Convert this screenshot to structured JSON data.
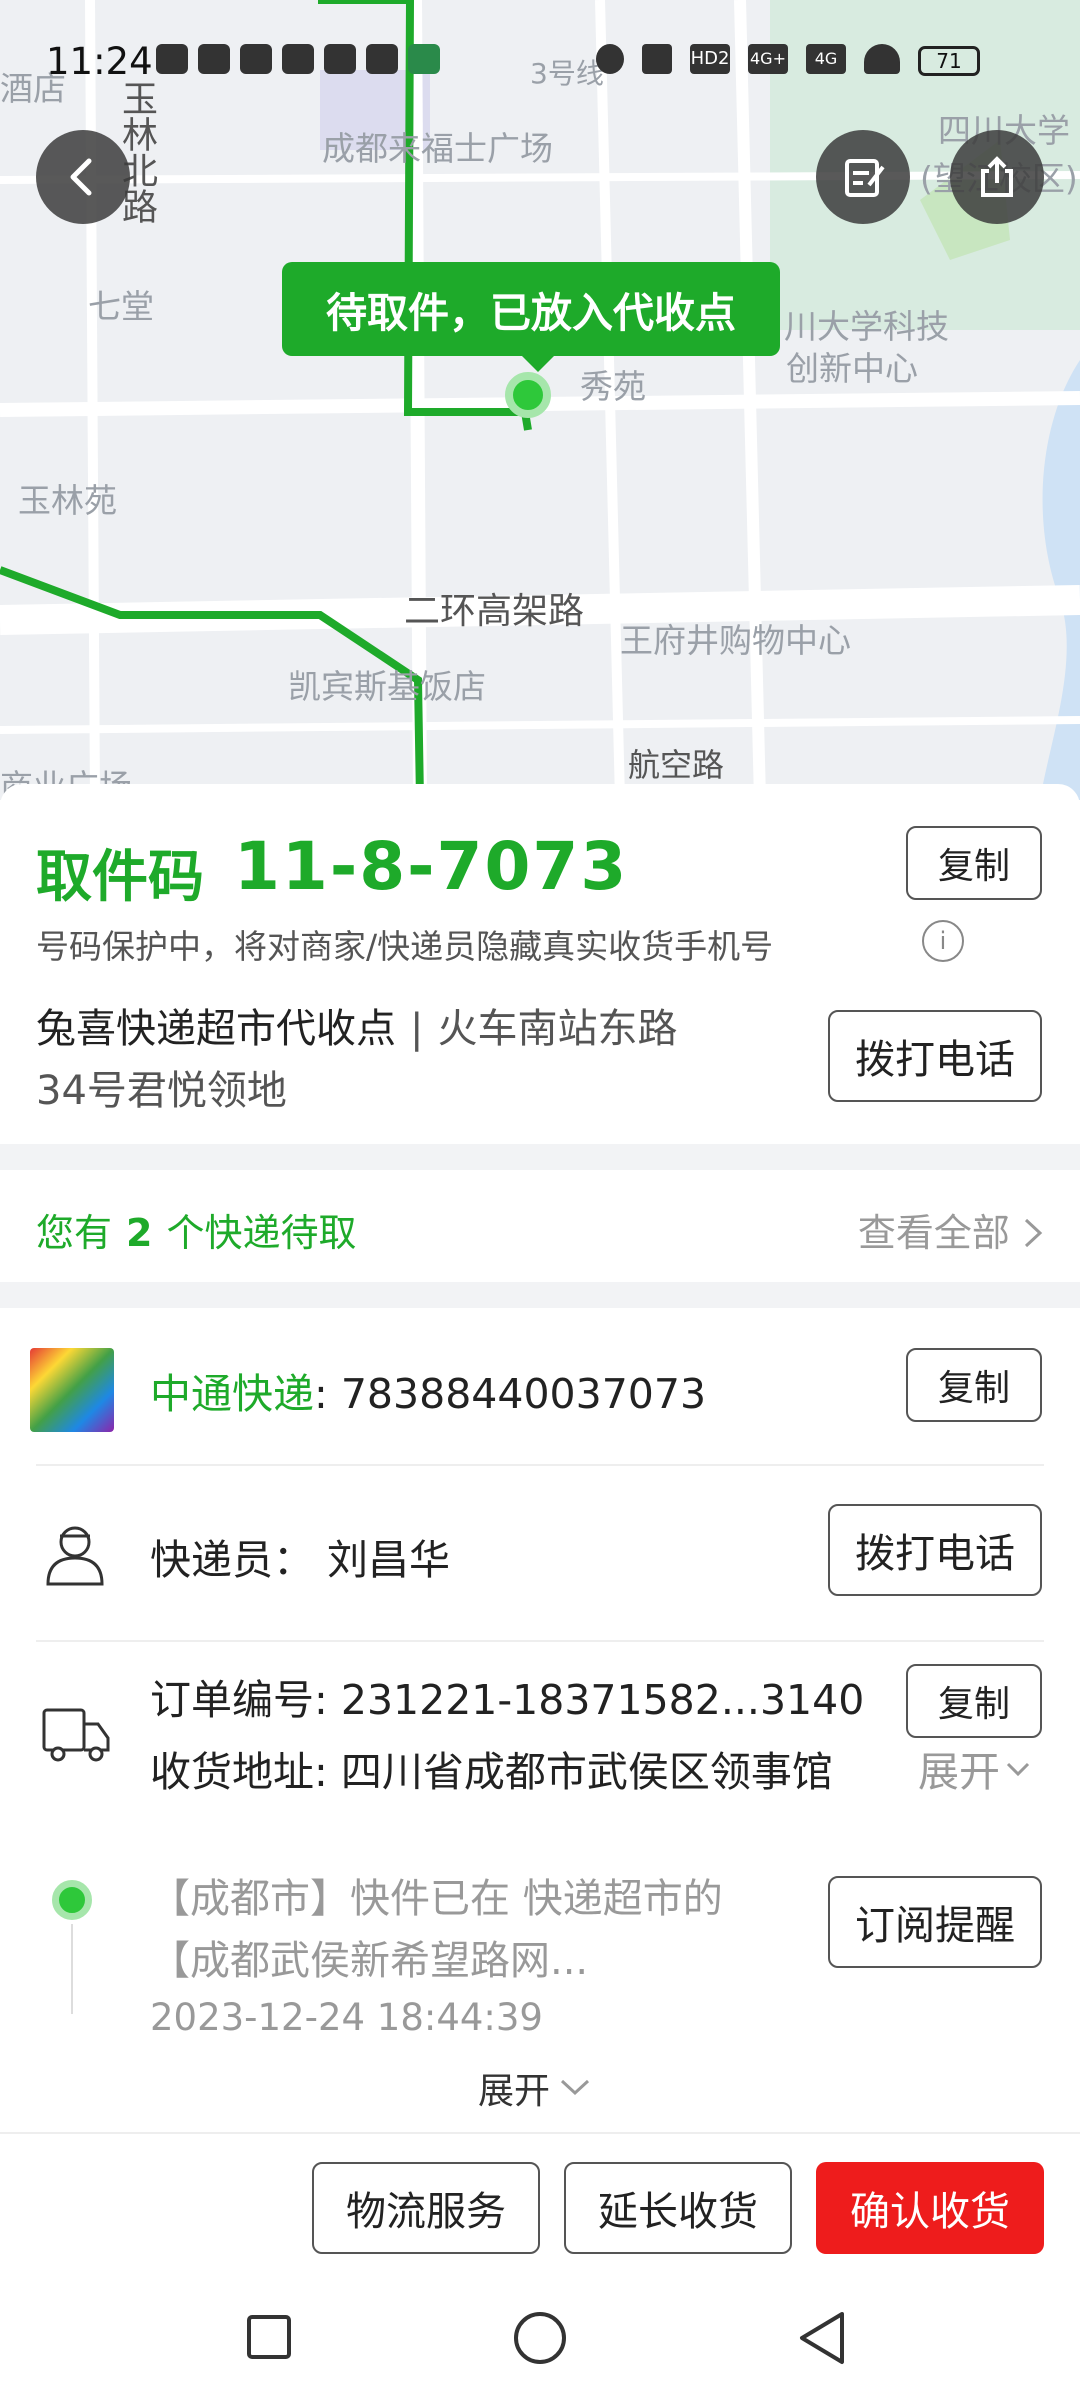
{
  "status_bar": {
    "time": "11:24",
    "battery": "71",
    "network_labels": [
      "HD2",
      "4G+",
      "4G"
    ]
  },
  "map": {
    "labels": [
      "酒店",
      "玉林北路",
      "成都来福士广场",
      "3号线",
      "四川大学",
      "(望江校区)",
      "七堂",
      "川大学科技",
      "创新中心",
      "秀苑",
      "玉林苑",
      "二环高架路",
      "王府井购物中心",
      "凯宾斯基饭店",
      "航空路",
      "商业广场"
    ],
    "bubble": "待取件，已放入代收点",
    "route_color": "#1eaa2a"
  },
  "pickup": {
    "label": "取件码",
    "code": "11-8-7073",
    "copy_label": "复制",
    "protect_note": "号码保护中，将对商家/快递员隐藏真实收货手机号",
    "station_name": "兔喜快递超市代收点",
    "station_sep": "|",
    "station_addr_line1": "火车南站东路",
    "station_addr_line2": "34号君悦领地",
    "call_label": "拨打电话"
  },
  "pending": {
    "prefix": "您有",
    "count": "2",
    "suffix": "个快递待取",
    "view_all": "查看全部"
  },
  "details": {
    "carrier": "中通快递",
    "tracking_no": ": 78388440037073",
    "copy_label": "复制",
    "courier_label": "快递员：",
    "courier_name": "刘昌华",
    "call_label": "拨打电话",
    "order_label": "订单编号: ",
    "order_no": "231221-18371582...3140",
    "order_copy_label": "复制",
    "addr_label": "收货地址: ",
    "addr": "四川省成都市武侯区领事馆",
    "addr_expand": "展开",
    "track_text": "【成都市】快件已在 快递超市的【成都武侯新希望路网...",
    "track_time": "2023-12-24  18:44:39",
    "subscribe_label": "订阅提醒",
    "expand_label": "展开"
  },
  "actions": {
    "logistics": "物流服务",
    "extend": "延长收货",
    "confirm": "确认收货"
  },
  "colors": {
    "accent": "#1eaa2a",
    "danger": "#ee1c1c"
  }
}
